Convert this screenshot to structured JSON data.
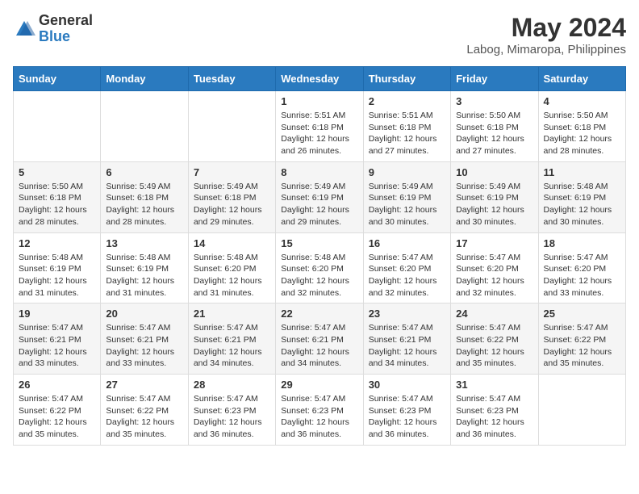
{
  "header": {
    "logo_general": "General",
    "logo_blue": "Blue",
    "month_year": "May 2024",
    "location": "Labog, Mimaropa, Philippines"
  },
  "columns": [
    "Sunday",
    "Monday",
    "Tuesday",
    "Wednesday",
    "Thursday",
    "Friday",
    "Saturday"
  ],
  "weeks": [
    [
      {
        "day": "",
        "info": ""
      },
      {
        "day": "",
        "info": ""
      },
      {
        "day": "",
        "info": ""
      },
      {
        "day": "1",
        "info": "Sunrise: 5:51 AM\nSunset: 6:18 PM\nDaylight: 12 hours and 26 minutes."
      },
      {
        "day": "2",
        "info": "Sunrise: 5:51 AM\nSunset: 6:18 PM\nDaylight: 12 hours and 27 minutes."
      },
      {
        "day": "3",
        "info": "Sunrise: 5:50 AM\nSunset: 6:18 PM\nDaylight: 12 hours and 27 minutes."
      },
      {
        "day": "4",
        "info": "Sunrise: 5:50 AM\nSunset: 6:18 PM\nDaylight: 12 hours and 28 minutes."
      }
    ],
    [
      {
        "day": "5",
        "info": "Sunrise: 5:50 AM\nSunset: 6:18 PM\nDaylight: 12 hours and 28 minutes."
      },
      {
        "day": "6",
        "info": "Sunrise: 5:49 AM\nSunset: 6:18 PM\nDaylight: 12 hours and 28 minutes."
      },
      {
        "day": "7",
        "info": "Sunrise: 5:49 AM\nSunset: 6:18 PM\nDaylight: 12 hours and 29 minutes."
      },
      {
        "day": "8",
        "info": "Sunrise: 5:49 AM\nSunset: 6:19 PM\nDaylight: 12 hours and 29 minutes."
      },
      {
        "day": "9",
        "info": "Sunrise: 5:49 AM\nSunset: 6:19 PM\nDaylight: 12 hours and 30 minutes."
      },
      {
        "day": "10",
        "info": "Sunrise: 5:49 AM\nSunset: 6:19 PM\nDaylight: 12 hours and 30 minutes."
      },
      {
        "day": "11",
        "info": "Sunrise: 5:48 AM\nSunset: 6:19 PM\nDaylight: 12 hours and 30 minutes."
      }
    ],
    [
      {
        "day": "12",
        "info": "Sunrise: 5:48 AM\nSunset: 6:19 PM\nDaylight: 12 hours and 31 minutes."
      },
      {
        "day": "13",
        "info": "Sunrise: 5:48 AM\nSunset: 6:19 PM\nDaylight: 12 hours and 31 minutes."
      },
      {
        "day": "14",
        "info": "Sunrise: 5:48 AM\nSunset: 6:20 PM\nDaylight: 12 hours and 31 minutes."
      },
      {
        "day": "15",
        "info": "Sunrise: 5:48 AM\nSunset: 6:20 PM\nDaylight: 12 hours and 32 minutes."
      },
      {
        "day": "16",
        "info": "Sunrise: 5:47 AM\nSunset: 6:20 PM\nDaylight: 12 hours and 32 minutes."
      },
      {
        "day": "17",
        "info": "Sunrise: 5:47 AM\nSunset: 6:20 PM\nDaylight: 12 hours and 32 minutes."
      },
      {
        "day": "18",
        "info": "Sunrise: 5:47 AM\nSunset: 6:20 PM\nDaylight: 12 hours and 33 minutes."
      }
    ],
    [
      {
        "day": "19",
        "info": "Sunrise: 5:47 AM\nSunset: 6:21 PM\nDaylight: 12 hours and 33 minutes."
      },
      {
        "day": "20",
        "info": "Sunrise: 5:47 AM\nSunset: 6:21 PM\nDaylight: 12 hours and 33 minutes."
      },
      {
        "day": "21",
        "info": "Sunrise: 5:47 AM\nSunset: 6:21 PM\nDaylight: 12 hours and 34 minutes."
      },
      {
        "day": "22",
        "info": "Sunrise: 5:47 AM\nSunset: 6:21 PM\nDaylight: 12 hours and 34 minutes."
      },
      {
        "day": "23",
        "info": "Sunrise: 5:47 AM\nSunset: 6:21 PM\nDaylight: 12 hours and 34 minutes."
      },
      {
        "day": "24",
        "info": "Sunrise: 5:47 AM\nSunset: 6:22 PM\nDaylight: 12 hours and 35 minutes."
      },
      {
        "day": "25",
        "info": "Sunrise: 5:47 AM\nSunset: 6:22 PM\nDaylight: 12 hours and 35 minutes."
      }
    ],
    [
      {
        "day": "26",
        "info": "Sunrise: 5:47 AM\nSunset: 6:22 PM\nDaylight: 12 hours and 35 minutes."
      },
      {
        "day": "27",
        "info": "Sunrise: 5:47 AM\nSunset: 6:22 PM\nDaylight: 12 hours and 35 minutes."
      },
      {
        "day": "28",
        "info": "Sunrise: 5:47 AM\nSunset: 6:23 PM\nDaylight: 12 hours and 36 minutes."
      },
      {
        "day": "29",
        "info": "Sunrise: 5:47 AM\nSunset: 6:23 PM\nDaylight: 12 hours and 36 minutes."
      },
      {
        "day": "30",
        "info": "Sunrise: 5:47 AM\nSunset: 6:23 PM\nDaylight: 12 hours and 36 minutes."
      },
      {
        "day": "31",
        "info": "Sunrise: 5:47 AM\nSunset: 6:23 PM\nDaylight: 12 hours and 36 minutes."
      },
      {
        "day": "",
        "info": ""
      }
    ]
  ]
}
